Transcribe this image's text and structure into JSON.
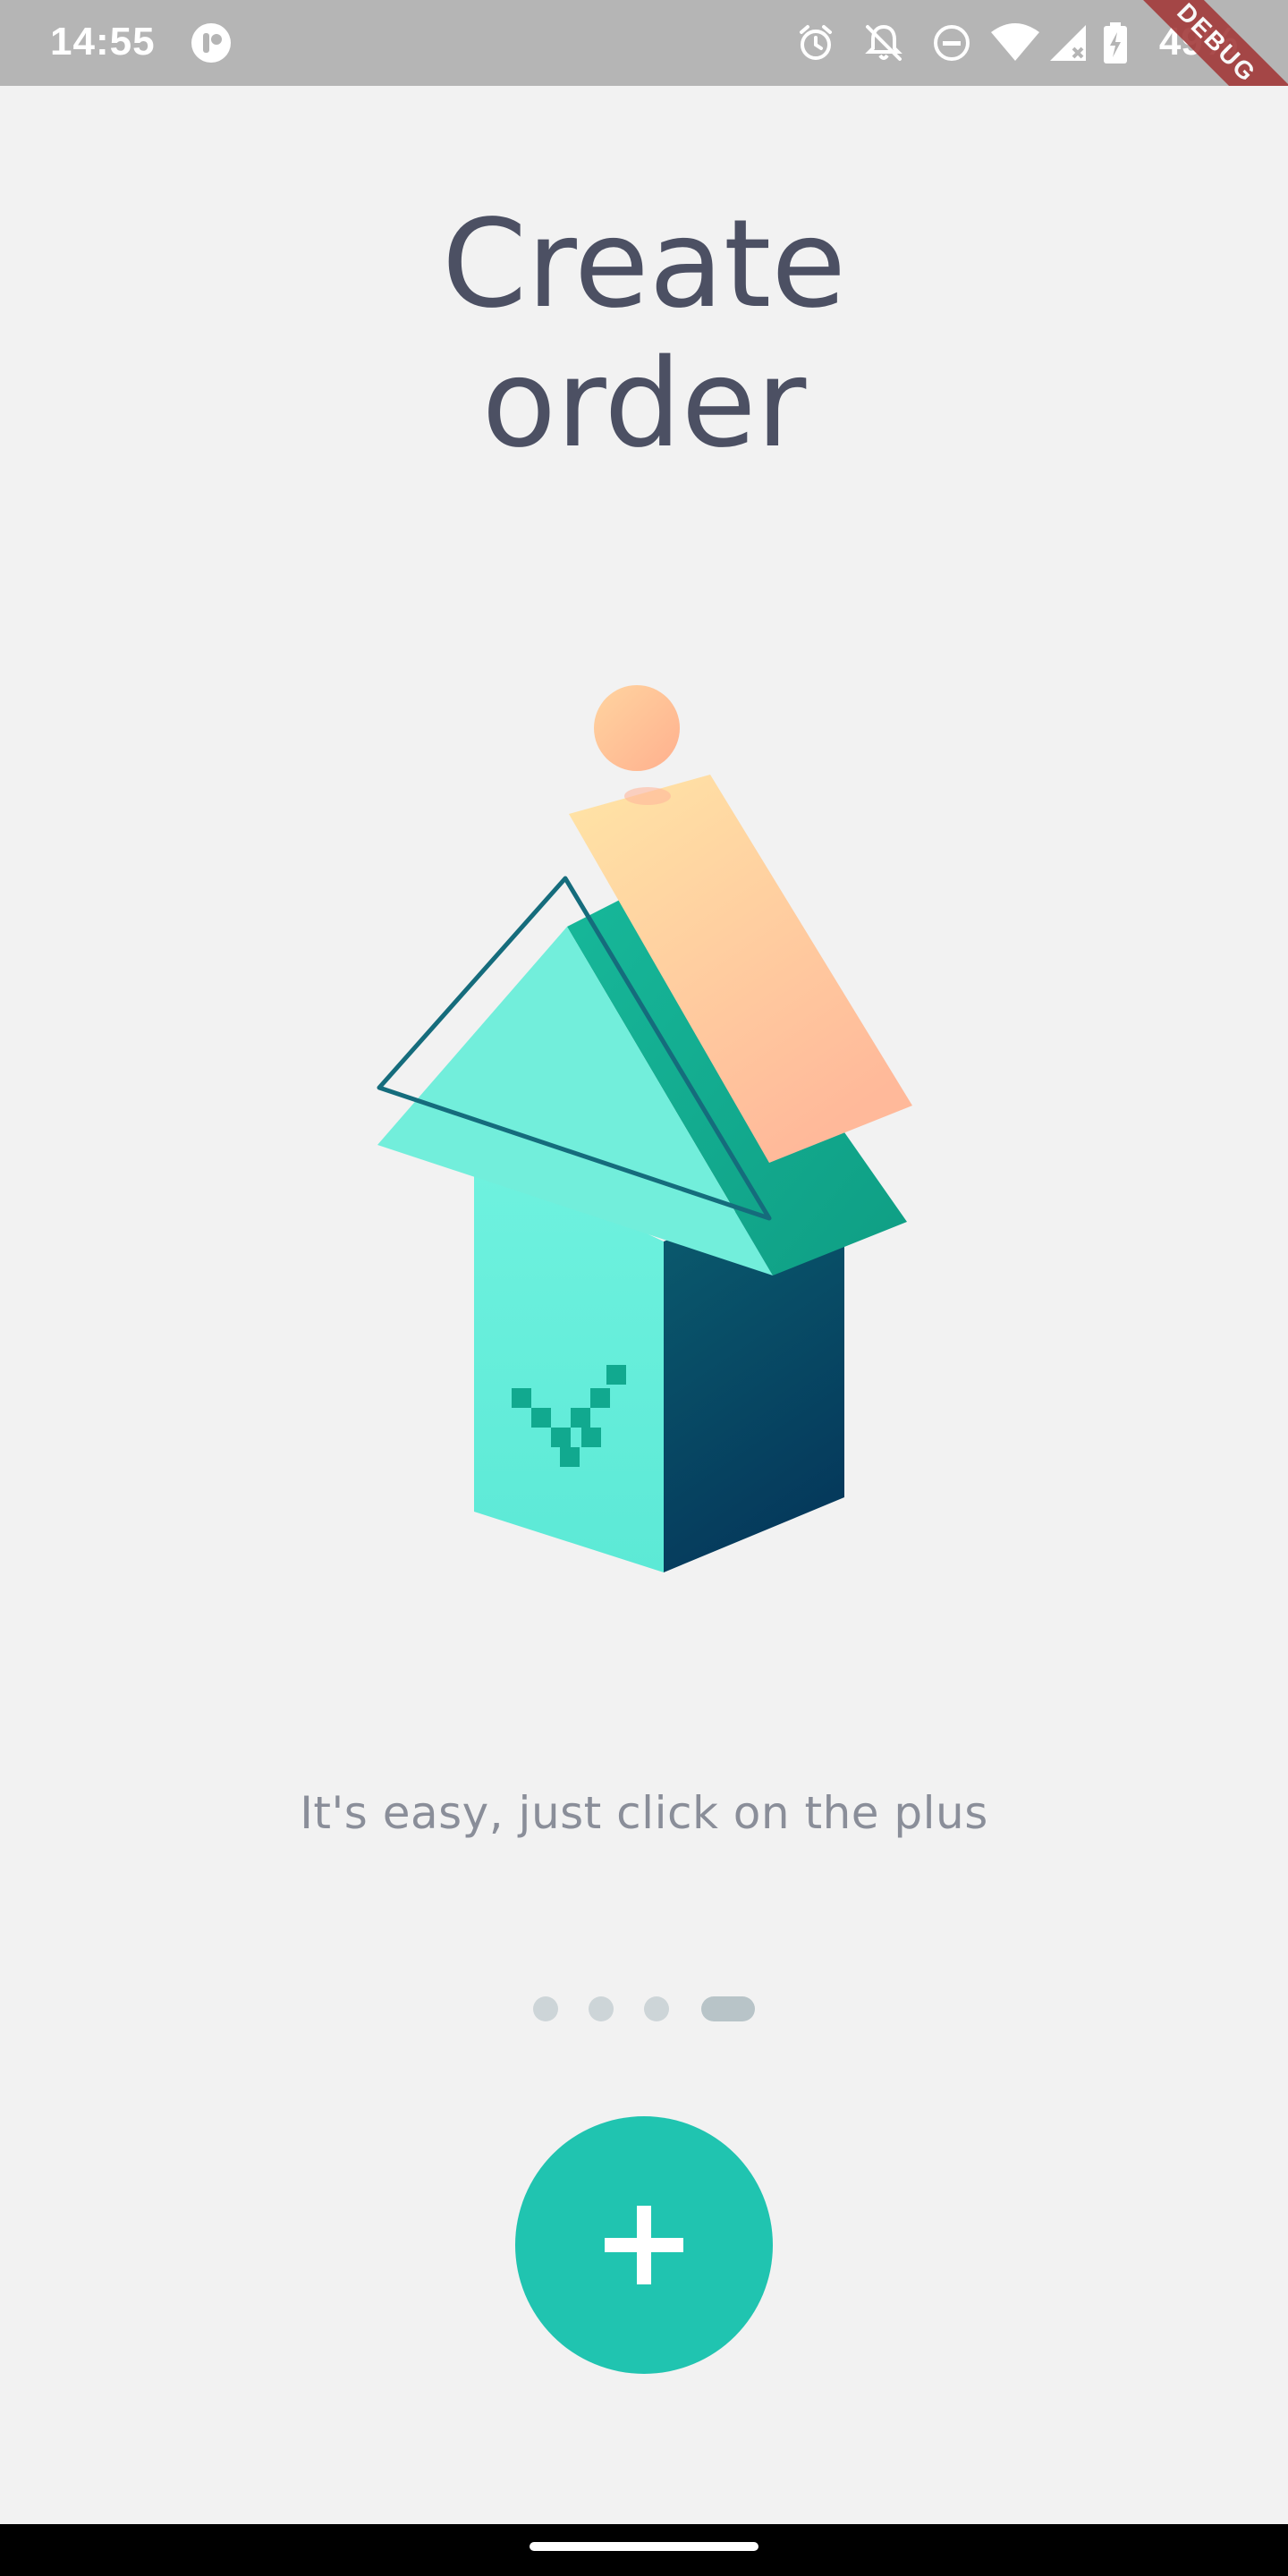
{
  "status_bar": {
    "time": "14:55",
    "battery": "49%",
    "debug_banner": "DEBUG",
    "icons": [
      "app-indicator-icon",
      "alarm-icon",
      "notifications-off-icon",
      "do-not-disturb-icon",
      "wifi-icon",
      "signal-icon",
      "battery-charging-icon"
    ]
  },
  "screen": {
    "title_line1": "Create",
    "title_line2": "order",
    "subtitle": "It's easy, just click on the plus",
    "pager": {
      "total": 4,
      "active_index": 3
    },
    "action_button_label": "+"
  },
  "colors": {
    "background": "#f2f2f2",
    "title": "#4c5063",
    "subtitle": "#8a8e99",
    "accent": "#20c4b0",
    "dot": "#cdd5d8",
    "dot_active": "#b8c4c8",
    "status_bar": "#b5b5b5"
  }
}
